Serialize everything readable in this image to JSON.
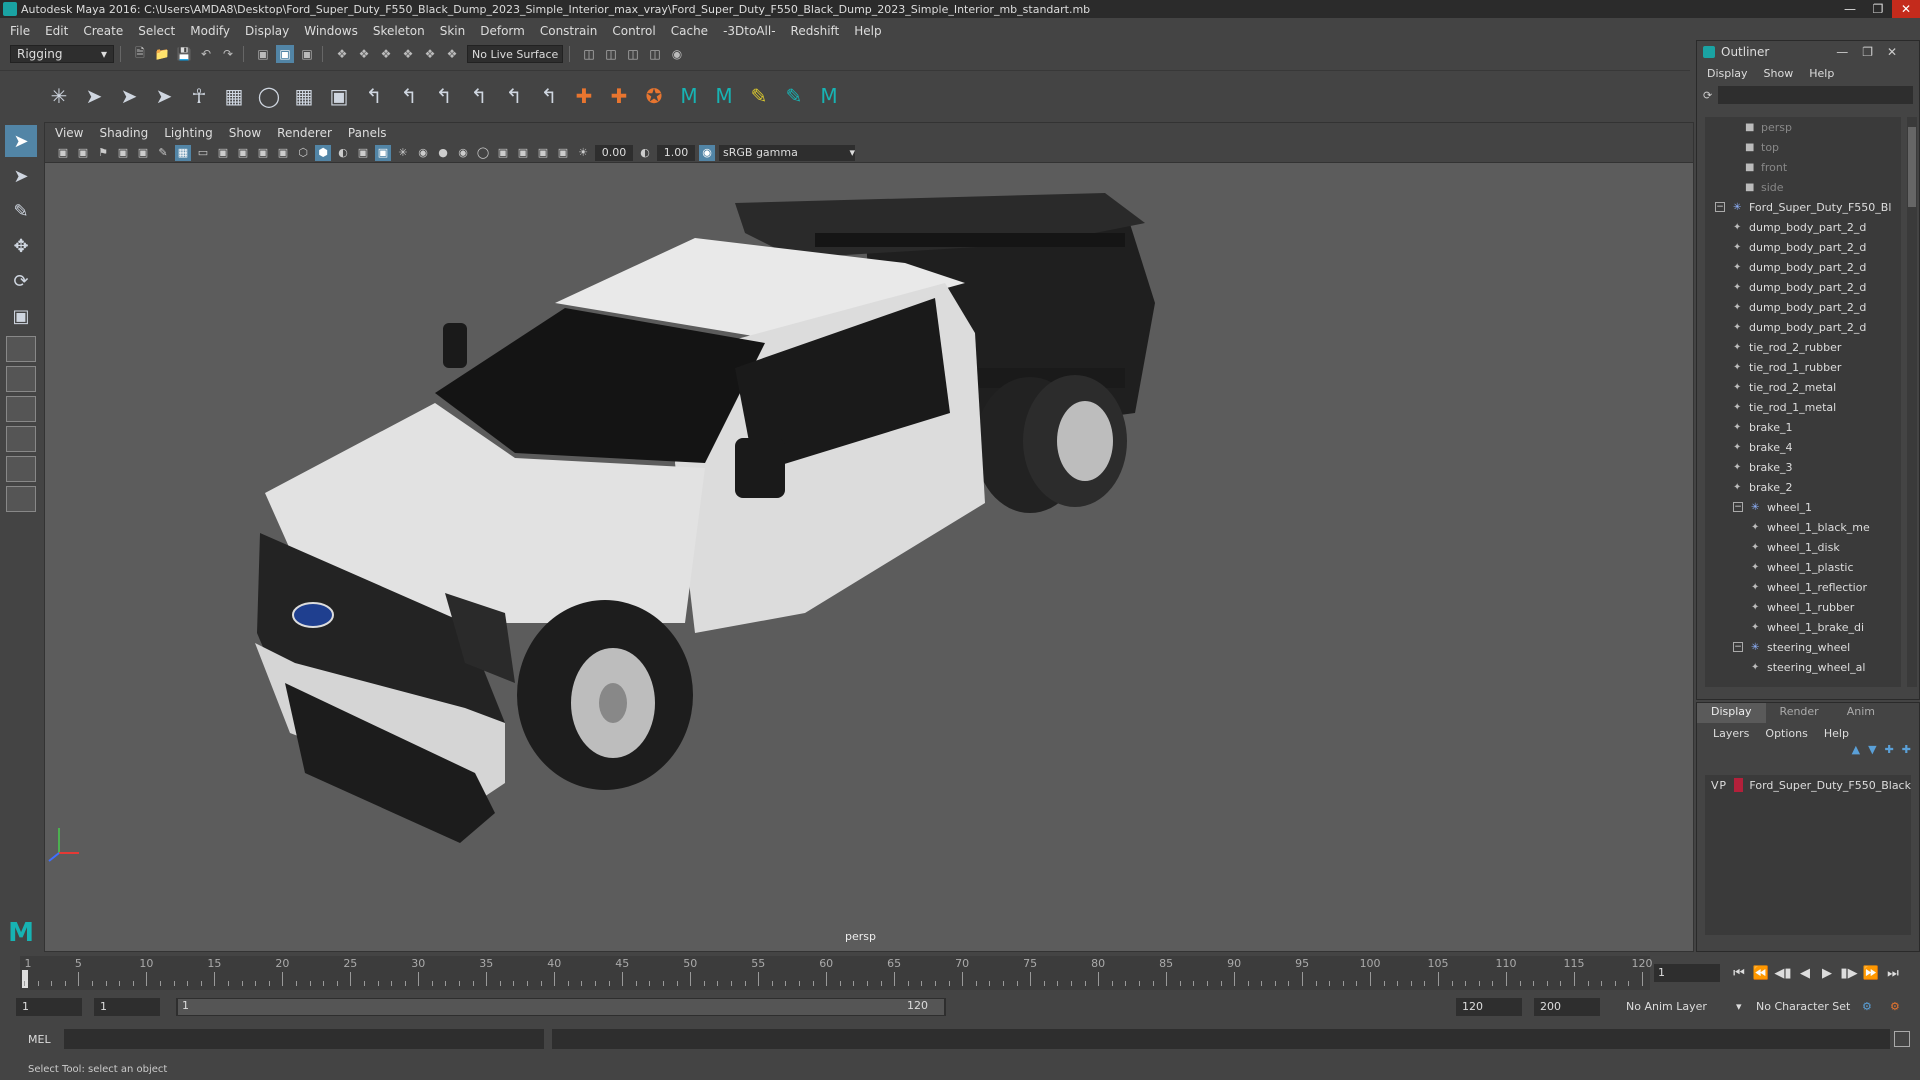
{
  "window": {
    "title": "Autodesk Maya 2016: C:\\Users\\AMDA8\\Desktop\\Ford_Super_Duty_F550_Black_Dump_2023_Simple_Interior_max_vray\\Ford_Super_Duty_F550_Black_Dump_2023_Simple_Interior_mb_standart.mb"
  },
  "menubar": [
    "File",
    "Edit",
    "Create",
    "Select",
    "Modify",
    "Display",
    "Windows",
    "Skeleton",
    "Skin",
    "Deform",
    "Constrain",
    "Control",
    "Cache",
    "-3DtoAll-",
    "Redshift",
    "Help"
  ],
  "statusline": {
    "mode": "Rigging",
    "live_surface": "No Live Surface"
  },
  "viewport": {
    "menu": [
      "View",
      "Shading",
      "Lighting",
      "Show",
      "Renderer",
      "Panels"
    ],
    "exposure": "0.00",
    "gamma": "1.00",
    "color_space": "sRGB gamma",
    "camera_label": "persp"
  },
  "outliner": {
    "title": "Outliner",
    "menu": [
      "Display",
      "Show",
      "Help"
    ],
    "items": [
      {
        "label": "persp",
        "type": "camera",
        "depth": 1
      },
      {
        "label": "top",
        "type": "camera",
        "depth": 1
      },
      {
        "label": "front",
        "type": "camera",
        "depth": 1
      },
      {
        "label": "side",
        "type": "camera",
        "depth": 1
      },
      {
        "label": "Ford_Super_Duty_F550_Bl",
        "type": "group",
        "depth": 0,
        "expanded": true
      },
      {
        "label": "dump_body_part_2_d",
        "type": "mesh",
        "depth": 1
      },
      {
        "label": "dump_body_part_2_d",
        "type": "mesh",
        "depth": 1
      },
      {
        "label": "dump_body_part_2_d",
        "type": "mesh",
        "depth": 1
      },
      {
        "label": "dump_body_part_2_d",
        "type": "mesh",
        "depth": 1
      },
      {
        "label": "dump_body_part_2_d",
        "type": "mesh",
        "depth": 1
      },
      {
        "label": "dump_body_part_2_d",
        "type": "mesh",
        "depth": 1
      },
      {
        "label": "tie_rod_2_rubber",
        "type": "mesh",
        "depth": 1
      },
      {
        "label": "tie_rod_1_rubber",
        "type": "mesh",
        "depth": 1
      },
      {
        "label": "tie_rod_2_metal",
        "type": "mesh",
        "depth": 1
      },
      {
        "label": "tie_rod_1_metal",
        "type": "mesh",
        "depth": 1
      },
      {
        "label": "brake_1",
        "type": "mesh",
        "depth": 1
      },
      {
        "label": "brake_4",
        "type": "mesh",
        "depth": 1
      },
      {
        "label": "brake_3",
        "type": "mesh",
        "depth": 1
      },
      {
        "label": "brake_2",
        "type": "mesh",
        "depth": 1
      },
      {
        "label": "wheel_1",
        "type": "group",
        "depth": 1,
        "expanded": true
      },
      {
        "label": "wheel_1_black_me",
        "type": "mesh",
        "depth": 2
      },
      {
        "label": "wheel_1_disk",
        "type": "mesh",
        "depth": 2
      },
      {
        "label": "wheel_1_plastic",
        "type": "mesh",
        "depth": 2
      },
      {
        "label": "wheel_1_reflectior",
        "type": "mesh",
        "depth": 2
      },
      {
        "label": "wheel_1_rubber",
        "type": "mesh",
        "depth": 2
      },
      {
        "label": "wheel_1_brake_di",
        "type": "mesh",
        "depth": 2
      },
      {
        "label": "steering_wheel",
        "type": "group",
        "depth": 1,
        "expanded": true
      },
      {
        "label": "steering_wheel_al",
        "type": "mesh",
        "depth": 2
      }
    ]
  },
  "layers": {
    "tabs": [
      "Display",
      "Render",
      "Anim"
    ],
    "menu": [
      "Layers",
      "Options",
      "Help"
    ],
    "rows": [
      {
        "v": "V",
        "p": "P",
        "name": "Ford_Super_Duty_F550_Black",
        "color": "#b3203a"
      }
    ]
  },
  "timeline": {
    "ticks": [
      "5",
      "10",
      "15",
      "20",
      "25",
      "30",
      "35",
      "40",
      "45",
      "50",
      "55",
      "60",
      "65",
      "70",
      "75",
      "80",
      "85",
      "90",
      "95",
      "100",
      "105",
      "110",
      "115",
      "120"
    ],
    "first_tick": "1",
    "current_frame": "1"
  },
  "range": {
    "start": "1",
    "playback_start": "1",
    "range_start": "1",
    "range_end": "120",
    "playback_end": "120",
    "end": "200",
    "anim_layer": "No Anim Layer",
    "character_set": "No Character Set"
  },
  "cmdline": {
    "label": "MEL"
  },
  "helpline": {
    "text": "Select Tool: select an object"
  },
  "colors": {
    "accent": "#5285a6",
    "maya_teal": "#17b3b3",
    "layer_red": "#b3203a"
  }
}
